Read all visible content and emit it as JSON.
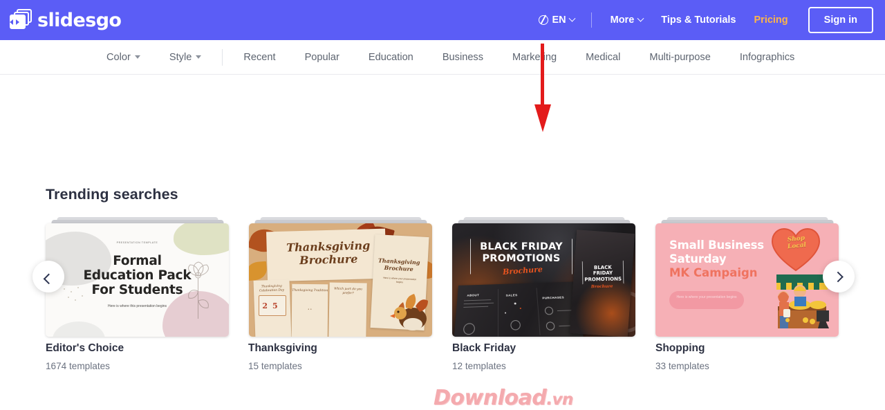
{
  "header": {
    "logo_text": "slidesgo",
    "logo_icon": "slides-stack-icon",
    "language": {
      "icon": "globe-icon",
      "label": "EN",
      "chevron": "chevron-down-icon"
    },
    "links": [
      {
        "label": "More",
        "chevron": "chevron-down-icon"
      },
      {
        "label": "Tips & Tutorials"
      },
      {
        "label": "Pricing"
      }
    ],
    "sign_in": "Sign in",
    "bg_color": "#5b5df6",
    "pricing_color": "#ffb547"
  },
  "subnav": {
    "filters": [
      {
        "label": "Color",
        "caret": "caret-down-icon"
      },
      {
        "label": "Style",
        "caret": "caret-down-icon"
      }
    ],
    "categories": [
      "Recent",
      "Popular",
      "Education",
      "Business",
      "Marketing",
      "Medical",
      "Multi-purpose",
      "Infographics"
    ]
  },
  "main": {
    "section_title": "Trending searches",
    "prev_label": "‹",
    "next_label": "›",
    "cards": [
      {
        "title": "Editor's Choice",
        "templates": "1674 templates",
        "slide": {
          "eyebrow": "PRESENTATION TEMPLATE",
          "title": "Formal\nEducation Pack\nFor Students",
          "title_line1": "Formal",
          "title_line2": "Education Pack",
          "title_line3": "For Students",
          "subtitle": "Here is where this presentation begins"
        }
      },
      {
        "title": "Thanksgiving",
        "templates": "15 templates",
        "slide": {
          "title_line1": "Thanksgiving",
          "title_line2": "Brochure",
          "right_title_line1": "Thanksgiving",
          "right_title_line2": "Brochure",
          "right_sub": "Here is where your presentation begins",
          "mini1_title": "Thanksgiving Celebration Day",
          "mini1_day": "25",
          "mini2_title": "Thanksgiving Tradition",
          "mini3_title": "Which part do you prefer?"
        }
      },
      {
        "title": "Black Friday",
        "templates": "12 templates",
        "slide": {
          "title_line1": "BLACK FRIDAY",
          "title_line2": "PROMOTIONS",
          "script": "Brochure",
          "label_sales": "SALES",
          "label_purchases": "PURCHASES",
          "right_title_line1": "BLACK",
          "right_title_line2": "FRIDAY",
          "right_title_line3": "PROMOTIONS",
          "right_script": "Brochure"
        }
      },
      {
        "title": "Shopping",
        "templates": "33 templates",
        "slide": {
          "title_line1": "Small Business",
          "title_line2": "Saturday",
          "title_line3": "MK Campaign",
          "pill": "Here is where your presentation begins",
          "heart_text_line1": "Shop",
          "heart_text_line2": "Local"
        }
      }
    ]
  },
  "annotation": {
    "arrow_color": "#e31b1b",
    "arrow_name": "red-down-arrow"
  },
  "watermark": {
    "name": "Download",
    "tld": ".vn"
  }
}
